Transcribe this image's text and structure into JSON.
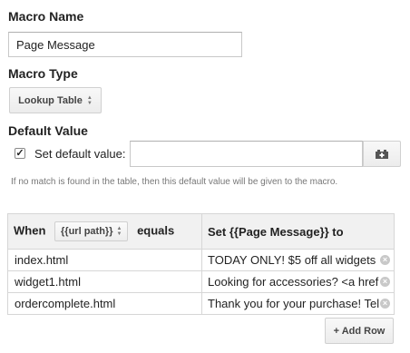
{
  "macro_name": {
    "label": "Macro Name",
    "value": "Page Message"
  },
  "macro_type": {
    "label": "Macro Type",
    "selected": "Lookup Table"
  },
  "default_value": {
    "label": "Default Value",
    "checkbox_label": "Set default value:",
    "checked": true,
    "value": "",
    "help": "If no match is found in the table, then this default value will be given to the macro."
  },
  "table": {
    "when_label": "When",
    "variable": "{{url path}}",
    "equals_label": "equals",
    "set_label": "Set {{Page Message}} to",
    "rows": [
      {
        "key": "index.html",
        "value": "TODAY ONLY! $5 off all widgets"
      },
      {
        "key": "widget1.html",
        "value": "Looking for accessories? <a href"
      },
      {
        "key": "ordercomplete.html",
        "value": "Thank you for your purchase! Tel"
      }
    ]
  },
  "add_row_label": "+ Add Row"
}
